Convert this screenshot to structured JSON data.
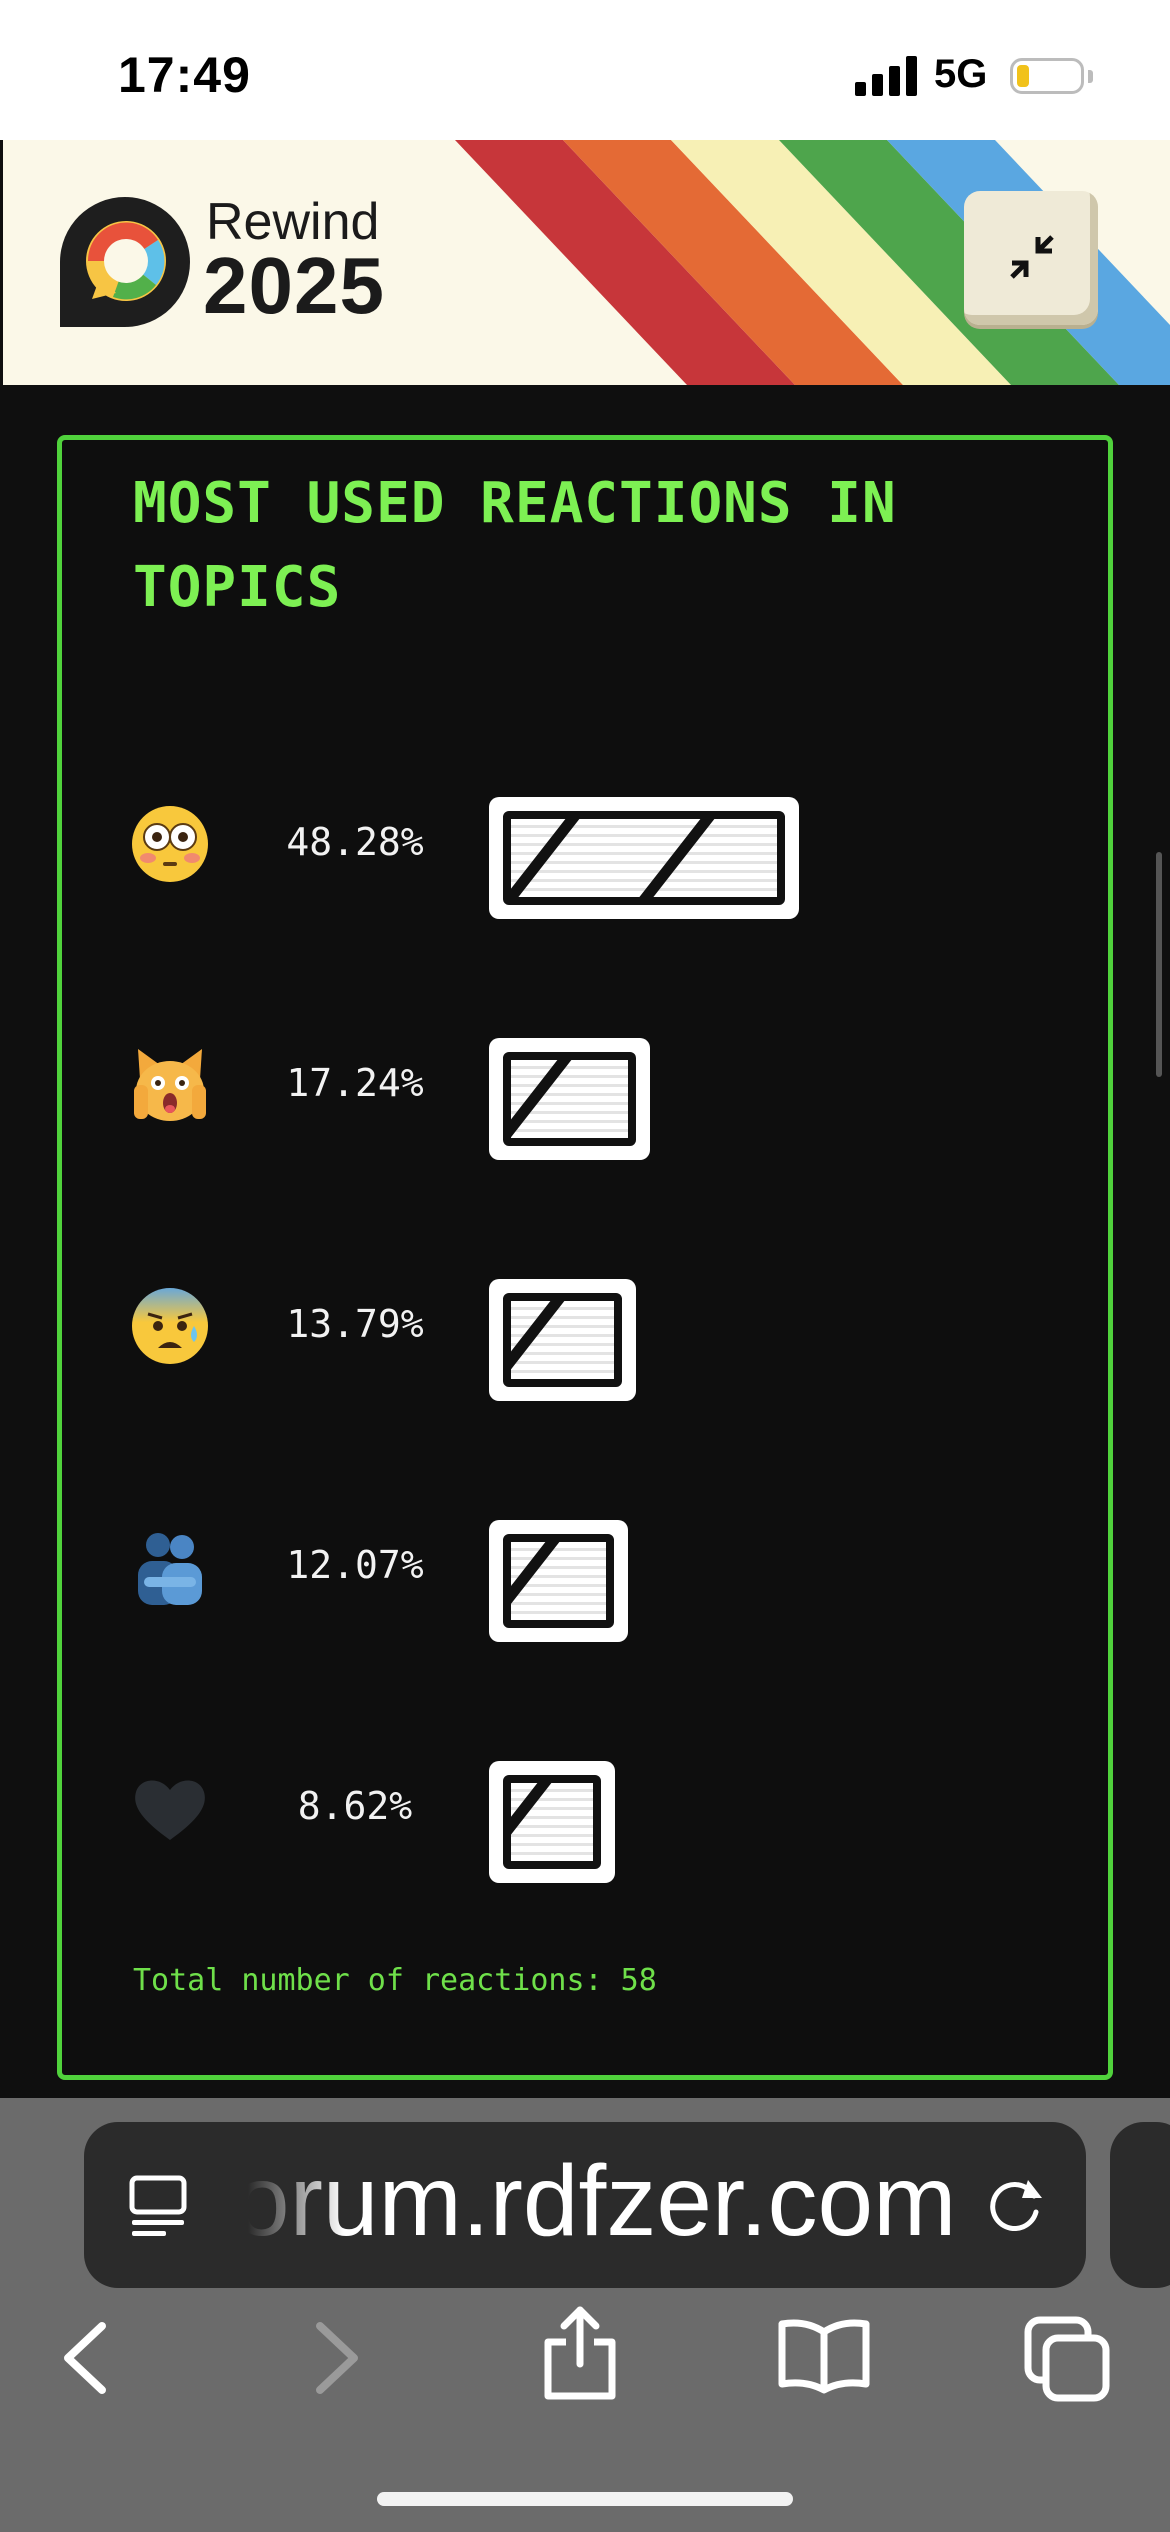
{
  "status_bar": {
    "time": "17:49",
    "network": "5G"
  },
  "header": {
    "brand": "Rewind",
    "year": "2025"
  },
  "colors": {
    "accent_green": "#7df053",
    "stripe_red": "#c7363a",
    "stripe_orange": "#e46a35",
    "stripe_yellow": "#f7f0b5",
    "stripe_green": "#4ea54c",
    "stripe_blue": "#5aa7e1"
  },
  "card": {
    "title": "MOST USED REACTIONS IN TOPICS",
    "reactions": [
      {
        "emoji_icon": "flushed-face-icon",
        "percent": "48.28%",
        "value": 48.28
      },
      {
        "emoji_icon": "weary-cat-face-icon",
        "percent": "17.24%",
        "value": 17.24
      },
      {
        "emoji_icon": "anxious-face-icon",
        "percent": "13.79%",
        "value": 13.79
      },
      {
        "emoji_icon": "people-hugging-icon",
        "percent": "12.07%",
        "value": 12.07
      },
      {
        "emoji_icon": "black-heart-icon",
        "percent": "8.62%",
        "value": 8.62
      }
    ],
    "total_text": "Total number of reactions: 58"
  },
  "browser": {
    "url_display": "orum.rdfzer.com"
  }
}
